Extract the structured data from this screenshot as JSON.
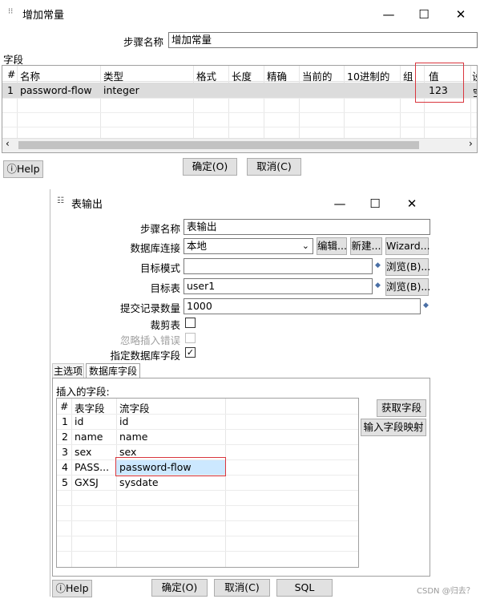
{
  "dialog1": {
    "title": "增加常量",
    "step_name_label": "步骤名称",
    "step_name_value": "增加常量",
    "fields_label": "字段",
    "columns": [
      "#",
      "名称",
      "类型",
      "格式",
      "长度",
      "精确",
      "当前的",
      "10进制的",
      "组",
      "值",
      "设"
    ],
    "rows": [
      {
        "num": "1",
        "name": "password-flow",
        "type": "integer",
        "value": "123",
        "partial": "空"
      }
    ],
    "help_label": "Help",
    "ok_label": "确定(O)",
    "cancel_label": "取消(C)"
  },
  "dialog2": {
    "title": "表输出",
    "step_name_label": "步骤名称",
    "step_name_value": "表输出",
    "connection_label": "数据库连接",
    "connection_value": "本地",
    "edit_label": "编辑...",
    "new_label": "新建...",
    "wizard_label": "Wizard...",
    "schema_label": "目标模式",
    "schema_value": "",
    "browse_label": "浏览(B)...",
    "table_label": "目标表",
    "table_value": "user1",
    "commit_label": "提交记录数量",
    "commit_value": "1000",
    "truncate_label": "裁剪表",
    "ignore_errors_label": "忽略插入错误",
    "specify_fields_label": "指定数据库字段",
    "tab_main": "主选项",
    "tab_fields": "数据库字段",
    "inserted_fields_label": "插入的字段:",
    "columns": [
      "#",
      "表字段",
      "流字段"
    ],
    "rows": [
      {
        "num": "1",
        "table_field": "id",
        "stream_field": "id"
      },
      {
        "num": "2",
        "table_field": "name",
        "stream_field": "name"
      },
      {
        "num": "3",
        "table_field": "sex",
        "stream_field": "sex"
      },
      {
        "num": "4",
        "table_field": "PASS...",
        "stream_field": "password-flow"
      },
      {
        "num": "5",
        "table_field": "GXSJ",
        "stream_field": "sysdate"
      }
    ],
    "get_fields_label": "获取字段",
    "map_fields_label": "输入字段映射",
    "help_label": "Help",
    "ok_label": "确定(O)",
    "cancel_label": "取消(C)",
    "sql_label": "SQL"
  },
  "watermark": "CSDN @归去？"
}
